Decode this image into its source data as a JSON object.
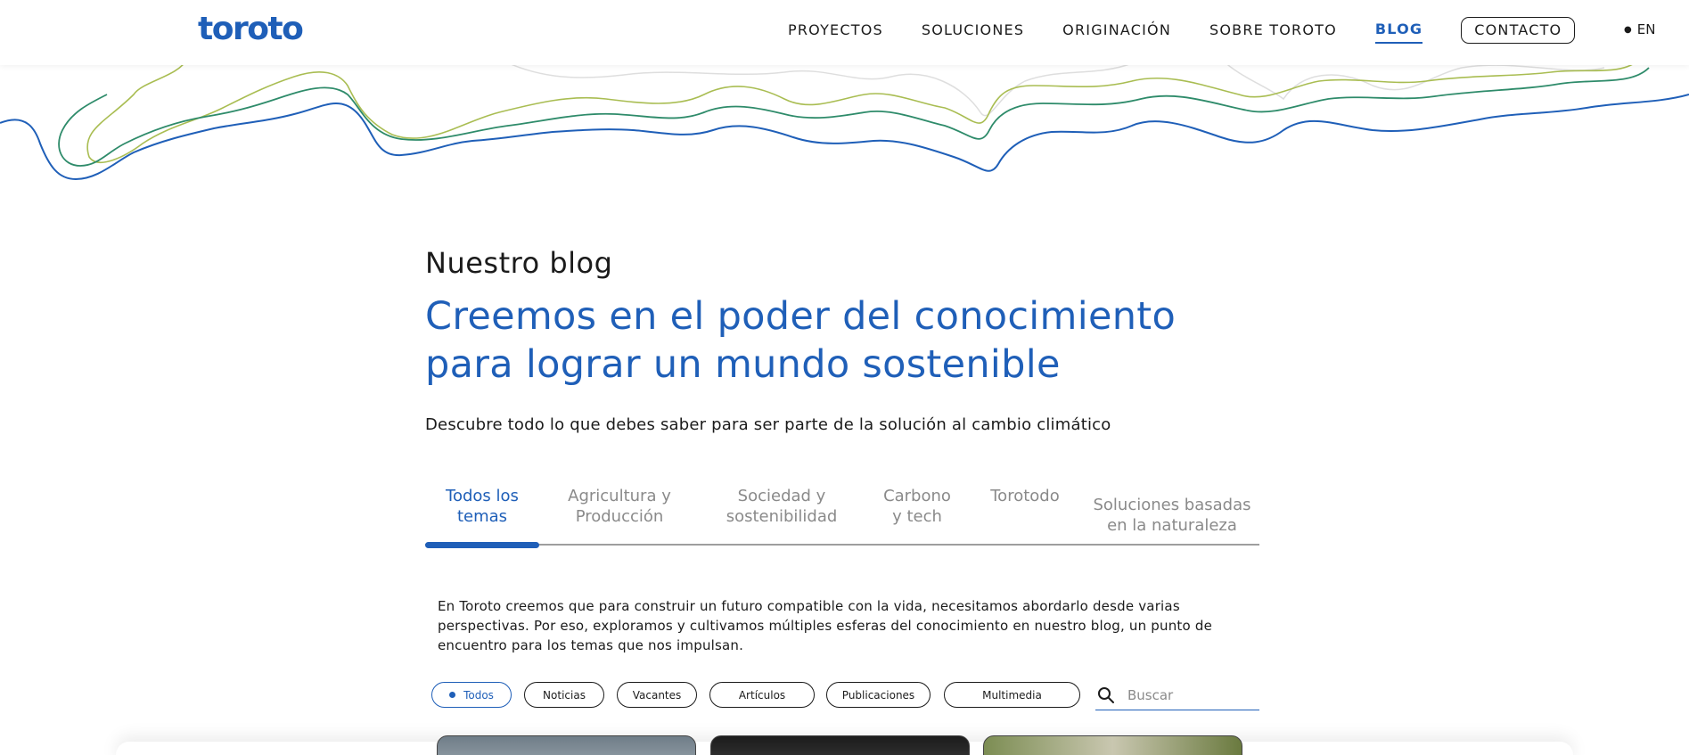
{
  "header": {
    "logo": "toroto",
    "nav": [
      "PROYECTOS",
      "SOLUCIONES",
      "ORIGINACIÓN",
      "SOBRE TOROTO",
      "BLOG"
    ],
    "active_nav": "BLOG",
    "contact_label": "CONTACTO",
    "lang_label": "EN"
  },
  "hero": {
    "eyebrow": "Nuestro blog",
    "headline": "Creemos en el poder del conocimiento para lograr un mundo sostenible",
    "subtitle": "Descubre todo lo que debes saber para ser parte de la solución al cambio climático"
  },
  "tabs": [
    {
      "line1": "Todos los",
      "line2": "temas"
    },
    {
      "line1": "Agricultura y",
      "line2": "Producción"
    },
    {
      "line1": "Sociedad y",
      "line2": "sostenibilidad"
    },
    {
      "line1": "Carbono",
      "line2": "y tech"
    },
    {
      "line1": "Torotodo",
      "line2": ""
    },
    {
      "line1": "Soluciones basadas",
      "line2": "en la naturaleza"
    }
  ],
  "active_tab": 0,
  "intro": "En Toroto creemos que para construir un futuro compatible con la vida, necesitamos abordarlo desde varias perspectivas. Por eso, exploramos y cultivamos múltiples esferas del conocimiento en nuestro blog, un punto de encuentro para los temas que nos impulsan.",
  "filters": [
    "Todos",
    "Noticias",
    "Vacantes",
    "Artículos",
    "Publicaciones",
    "Multimedia"
  ],
  "active_filter": "Todos",
  "search": {
    "placeholder": "Buscar",
    "icon": "search-icon"
  },
  "colors": {
    "brand_blue": "#1f5fb8",
    "wave_green": "#2e8b6a",
    "wave_lime": "#a9bd52",
    "wave_gray": "#d9d9d9"
  }
}
